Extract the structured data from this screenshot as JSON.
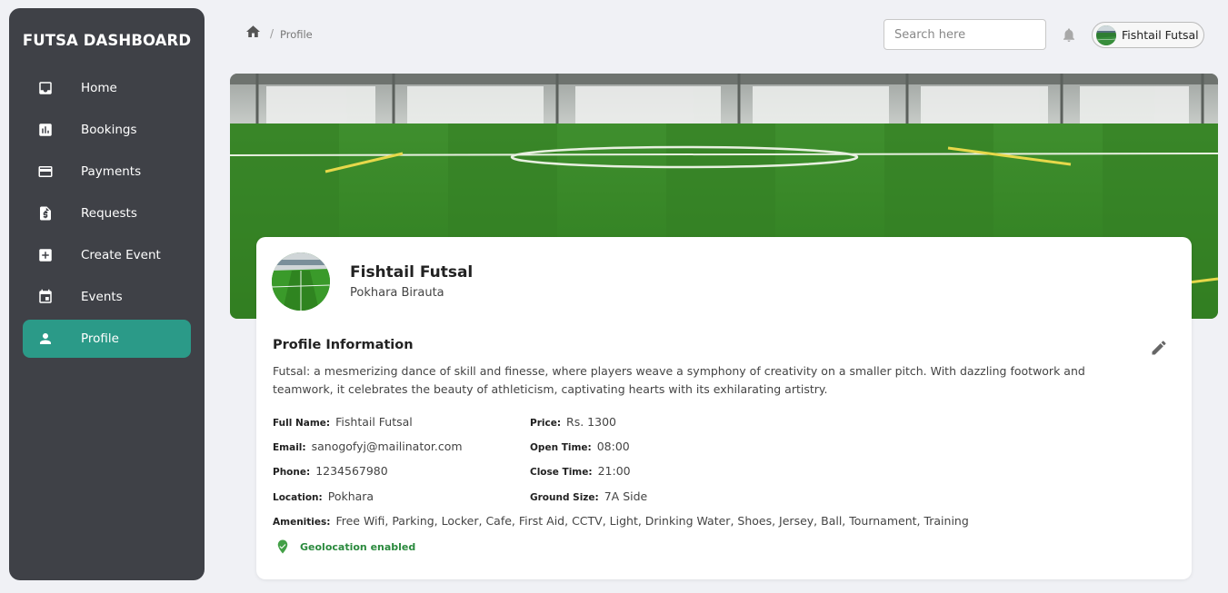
{
  "sidebar": {
    "brand": "FUTSA DASHBOARD",
    "items": [
      {
        "label": "Home",
        "icon": "inbox-icon"
      },
      {
        "label": "Bookings",
        "icon": "bar-chart-icon"
      },
      {
        "label": "Payments",
        "icon": "credit-card-icon"
      },
      {
        "label": "Requests",
        "icon": "invoice-icon"
      },
      {
        "label": "Create Event",
        "icon": "add-box-icon"
      },
      {
        "label": "Events",
        "icon": "calendar-icon"
      },
      {
        "label": "Profile",
        "icon": "person-icon",
        "active": true
      }
    ]
  },
  "header": {
    "breadcrumb_current": "Profile",
    "search_placeholder": "Search here",
    "user_name": "Fishtail Futsal"
  },
  "profile": {
    "name": "Fishtail Futsal",
    "location": "Pokhara Birauta",
    "section_title": "Profile Information",
    "description": "Futsal: a mesmerizing dance of skill and finesse, where players weave a symphony of creativity on a smaller pitch. With dazzling footwork and teamwork, it celebrates the beauty of athleticism, captivating hearts with its exhilarating artistry.",
    "full_name_label": "Full Name:",
    "full_name": "Fishtail Futsal",
    "email_label": "Email:",
    "email": "sanogofyj@mailinator.com",
    "phone_label": "Phone:",
    "phone": "1234567980",
    "location_label": "Location:",
    "location_value": "Pokhara",
    "price_label": "Price:",
    "price": "Rs. 1300",
    "open_label": "Open Time:",
    "open_time": "08:00",
    "close_label": "Close Time:",
    "close_time": "21:00",
    "ground_label": "Ground Size:",
    "ground_size": "7A Side",
    "amenities_label": "Amenities:",
    "amenities": "Free Wifi, Parking, Locker, Cafe, First Aid, CCTV, Light, Drinking Water, Shoes, Jersey, Ball, Tournament, Training",
    "geolocation": "Geolocation enabled"
  },
  "colors": {
    "sidebar_bg": "#3f4147",
    "accent": "#2b9a88",
    "geo_green": "#2b8a3e"
  }
}
